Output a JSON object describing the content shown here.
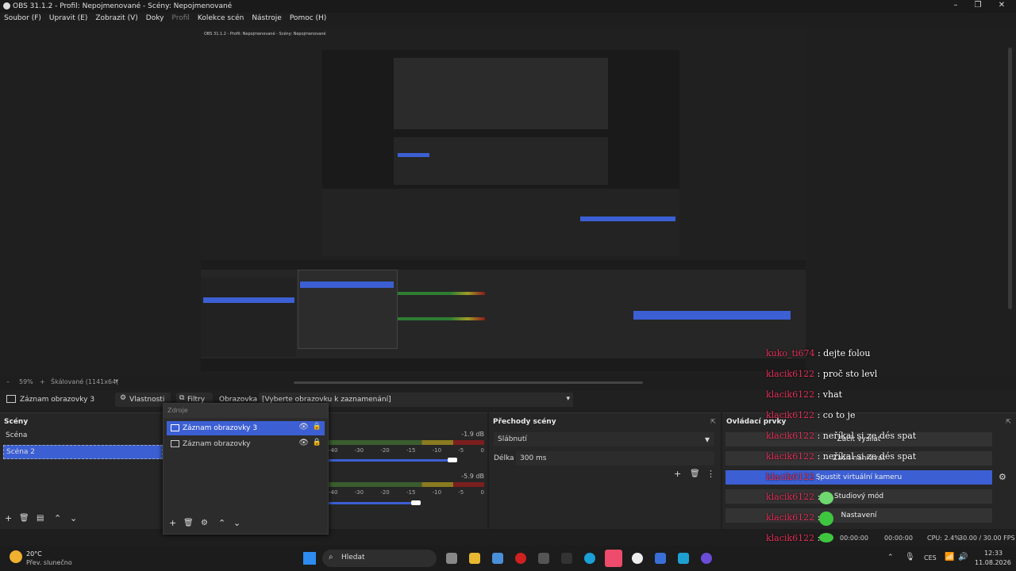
{
  "window": {
    "title": "OBS 31.1.2 - Profil: Nepojmenované - Scény: Nepojmenované",
    "controls": [
      "–",
      "❐",
      "✕"
    ]
  },
  "menu": {
    "items": [
      "Soubor (F)",
      "Upravit (E)",
      "Zobrazit (V)",
      "Doky",
      "Profil",
      "Kolekce scén",
      "Nástroje",
      "Pomoc (H)"
    ]
  },
  "preview": {
    "zoom": "59%",
    "scale_mode": "Škálované (1141x64(",
    "inner_title": "OBS 31.1.2 - Profil: Nepojmenované - Scény: Nepojmenované"
  },
  "source_toolbar": {
    "source_name": "Záznam obrazovky 3",
    "properties_label": "Vlastnosti",
    "filters_label": "Filtry",
    "display_label": "Obrazovka",
    "display_value": "[Vyberte obrazovku k zaznamenání]"
  },
  "scenes": {
    "title": "Scény",
    "items": [
      "Scéna",
      "Scéna 2"
    ],
    "selected": 1
  },
  "sources": {
    "placeholder": "Zdroje",
    "items": [
      "Záznam obrazovky 3",
      "Záznam obrazovky"
    ],
    "selected": 0
  },
  "mixer": {
    "db_values": [
      "-1.9 dB",
      "-5.9 dB"
    ],
    "ticks": [
      "-40",
      "-30",
      "-20",
      "-15",
      "-10",
      "-5",
      "0"
    ]
  },
  "transitions": {
    "title": "Přechody scény",
    "transition": "Slábnutí",
    "duration_label": "Délka",
    "duration": "300 ms"
  },
  "controls": {
    "title": "Ovládací prvky",
    "buttons": [
      "Začít vysílat",
      "Začít nahrávat",
      "Spustit virtuální kameru",
      "Studiový mód",
      "Nastavení"
    ]
  },
  "chat": [
    {
      "name": "kuko_ti674",
      "msg": ": dejte folou"
    },
    {
      "name": "klacik6122",
      "msg": ": proč sto levl"
    },
    {
      "name": "klacik6122",
      "msg": ": vhat"
    },
    {
      "name": "klacik6122",
      "msg": ": co to je"
    },
    {
      "name": "klacik6122",
      "msg": ": neříkal si ze dés spat"
    },
    {
      "name": "klacik6122",
      "msg": ": neříkal si ze dés spat"
    },
    {
      "name": "klacik6122",
      "msg": ":"
    },
    {
      "name": "klacik6122",
      "msg": ":"
    },
    {
      "name": "klacik6122",
      "msg": ":"
    },
    {
      "name": "klacik6122",
      "msg": ":"
    },
    {
      "name": "klacik6122",
      "msg": ":"
    }
  ],
  "status": {
    "time1": "00:00:00",
    "time2": "00:00:00",
    "cpu": "CPU: 2.4%",
    "fps": "30.00 / 30.00 FPS"
  },
  "taskbar": {
    "weather_temp": "20°C",
    "weather_desc": "Přev. slunečno",
    "search": "Hledat",
    "lang": "CES",
    "clock_time": "12:33",
    "clock_date": "11.08.2026"
  },
  "colors": {
    "accent": "#3c5fd3",
    "chat_name": "#e6315a"
  }
}
